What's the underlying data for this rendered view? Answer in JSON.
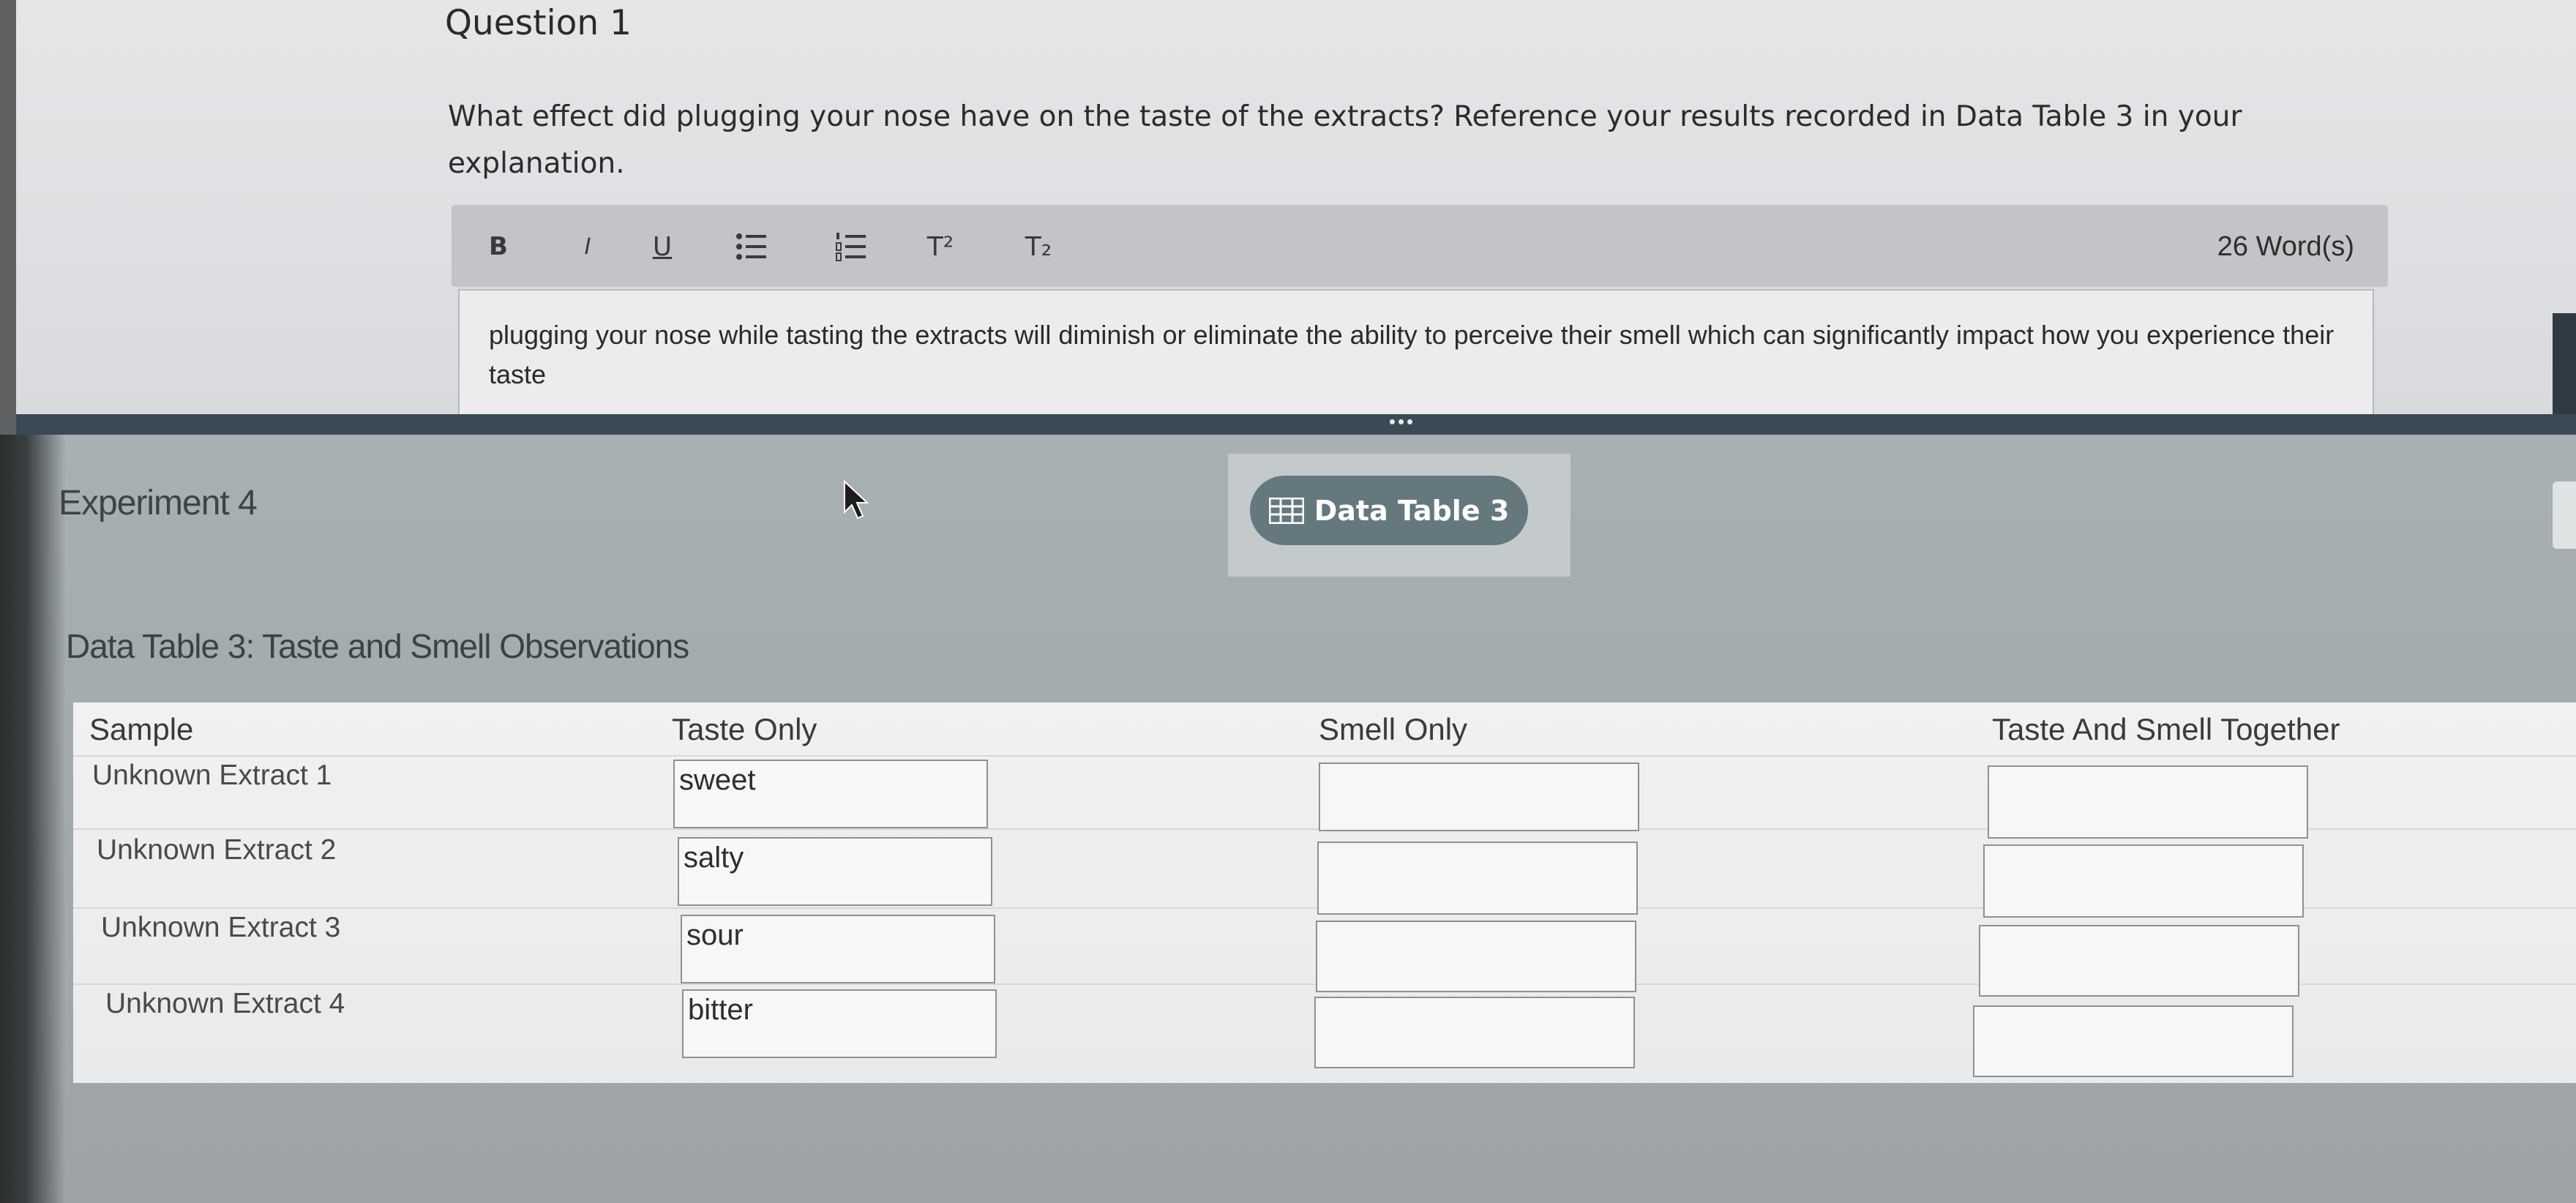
{
  "question": {
    "title": "Question 1",
    "prompt": "What effect did plugging your nose have on the taste of the extracts? Reference your results recorded in Data Table 3 in your explanation."
  },
  "toolbar": {
    "bold": "B",
    "italic": "I",
    "underline": "U",
    "bullet_list": "☰",
    "numbered_list": "☷",
    "superscript": "T²",
    "subscript": "T₂",
    "word_count": "26 Word(s)"
  },
  "answer": {
    "text": "plugging your nose while tasting the extracts will diminish or eliminate the ability to perceive their smell which can significantly impact how you experience their taste"
  },
  "divider": {
    "handle": "•••"
  },
  "experiment": {
    "title": "Experiment 4",
    "data_table_button": "Data Table 3",
    "table_caption": "Data Table 3: Taste and Smell Observations"
  },
  "table": {
    "headers": [
      "Sample",
      "Taste Only",
      "Smell Only",
      "Taste And Smell Together"
    ],
    "rows": [
      {
        "sample": "Unknown Extract 1",
        "taste_only": "sweet",
        "smell_only": "",
        "taste_and_smell": ""
      },
      {
        "sample": "Unknown Extract 2",
        "taste_only": "salty",
        "smell_only": "",
        "taste_and_smell": ""
      },
      {
        "sample": "Unknown Extract 3",
        "taste_only": "sour",
        "smell_only": "",
        "taste_and_smell": ""
      },
      {
        "sample": "Unknown Extract 4",
        "taste_only": "bitter",
        "smell_only": "",
        "taste_and_smell": ""
      }
    ]
  },
  "icons": {
    "table": "table-icon",
    "cursor": "mouse-pointer-icon"
  },
  "colors": {
    "button_bg": "#64787e",
    "divider": "#3a4a55",
    "panel_bg": "#a3aaad"
  }
}
